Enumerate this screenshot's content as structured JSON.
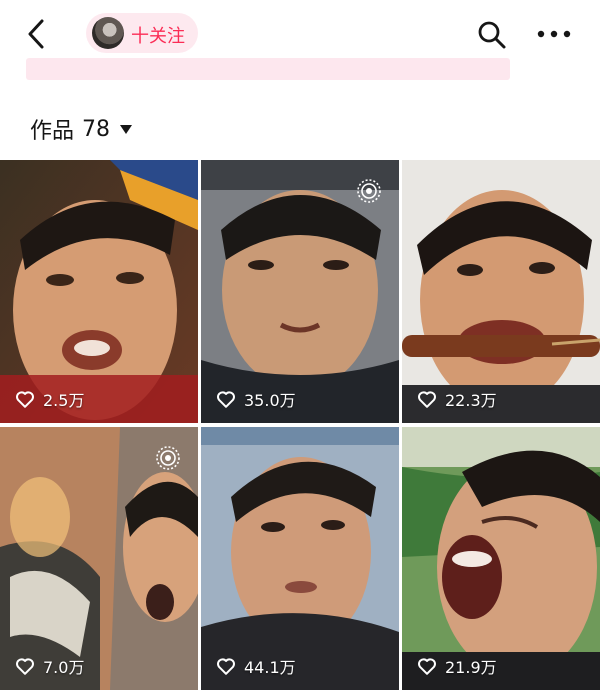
{
  "header": {
    "follow_label": "十关注",
    "icons": {
      "back": "chevron-left-icon",
      "search": "search-icon",
      "more": "more-horizontal-icon"
    }
  },
  "works": {
    "label": "作品",
    "count": "78"
  },
  "posts": [
    {
      "likes": "2.5万"
    },
    {
      "likes": "35.0万"
    },
    {
      "likes": "22.3万"
    },
    {
      "likes": "7.0万"
    },
    {
      "likes": "44.1万"
    },
    {
      "likes": "21.9万"
    }
  ],
  "colors": {
    "accent": "#fb2c55",
    "pill": "#fde9ef"
  }
}
